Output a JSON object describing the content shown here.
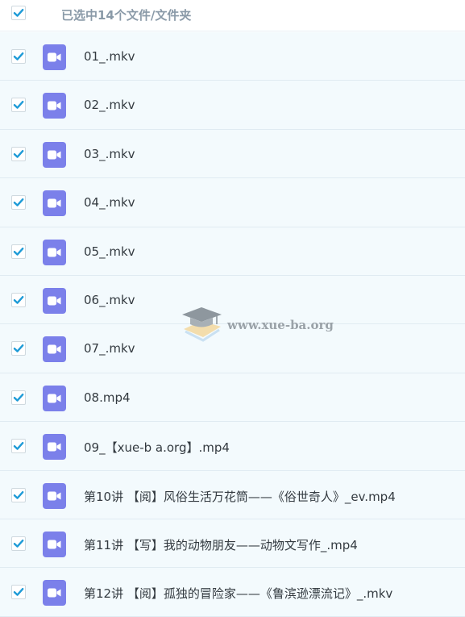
{
  "header": {
    "selection_text": "已选中14个文件/文件夹"
  },
  "files": [
    {
      "name": "01_.mkv",
      "icon": "video-icon"
    },
    {
      "name": "02_.mkv",
      "icon": "video-icon"
    },
    {
      "name": "03_.mkv",
      "icon": "video-icon"
    },
    {
      "name": "04_.mkv",
      "icon": "video-icon"
    },
    {
      "name": "05_.mkv",
      "icon": "video-icon"
    },
    {
      "name": "06_.mkv",
      "icon": "video-icon"
    },
    {
      "name": "07_.mkv",
      "icon": "video-icon"
    },
    {
      "name": "08.mp4",
      "icon": "video-icon"
    },
    {
      "name": "09_【xue-b a.org】.mp4",
      "icon": "video-icon"
    },
    {
      "name": "第10讲 【阅】风俗生活万花筒——《俗世奇人》_ev.mp4",
      "icon": "video-icon"
    },
    {
      "name": "第11讲 【写】我的动物朋友——动物文写作_.mp4",
      "icon": "video-icon"
    },
    {
      "name": "第12讲 【阅】孤独的冒险家——《鲁滨逊漂流记》_.mkv",
      "icon": "video-icon"
    }
  ],
  "watermark": {
    "text": "www.xue-ba.org"
  },
  "colors": {
    "checkbox_check": "#1e9bd7",
    "file_icon": "#7b80ea",
    "row_bg": "#f3fafd",
    "row_border": "#e0ebf2"
  }
}
